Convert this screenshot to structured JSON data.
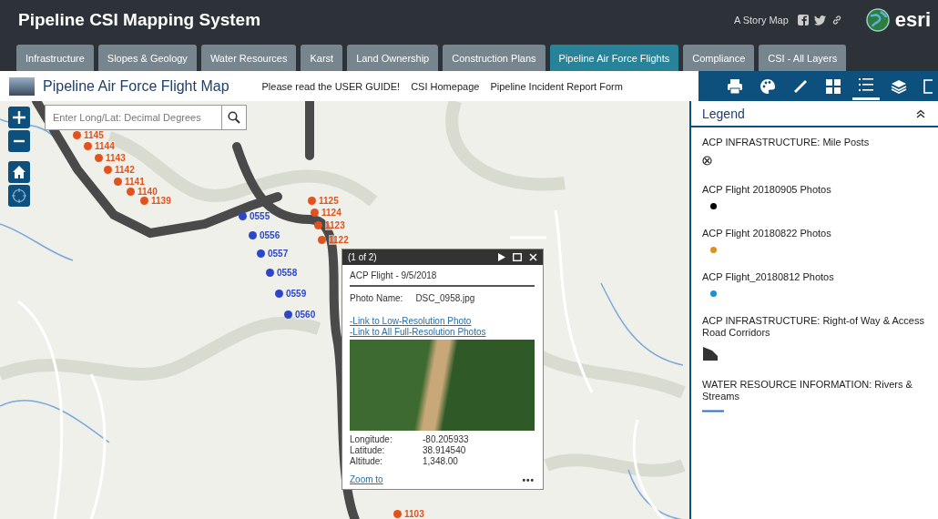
{
  "header": {
    "title": "Pipeline CSI Mapping System",
    "story_map": "A Story Map",
    "brand": "esri"
  },
  "tabs": [
    {
      "label": "Infrastructure",
      "selected": false
    },
    {
      "label": "Slopes & Geology",
      "selected": false
    },
    {
      "label": "Water Resources",
      "selected": false
    },
    {
      "label": "Karst",
      "selected": false
    },
    {
      "label": "Land Ownership",
      "selected": false
    },
    {
      "label": "Construction Plans",
      "selected": false
    },
    {
      "label": "Pipeline Air Force Flights",
      "selected": true
    },
    {
      "label": "Compliance",
      "selected": false
    },
    {
      "label": "CSI - All Layers",
      "selected": false
    }
  ],
  "subheader": {
    "title": "Pipeline Air Force Flight Map",
    "links": [
      "Please read the USER GUIDE!",
      "CSI Homepage",
      "Pipeline Incident Report Form"
    ]
  },
  "toolbar": [
    {
      "kind": "print",
      "selected": false
    },
    {
      "kind": "palette",
      "selected": false
    },
    {
      "kind": "ruler",
      "selected": false
    },
    {
      "kind": "grid",
      "selected": false
    },
    {
      "kind": "legend",
      "selected": true
    },
    {
      "kind": "layers",
      "selected": false
    },
    {
      "kind": "panel",
      "selected": false
    }
  ],
  "map": {
    "search": {
      "placeholder": "Enter Long/Lat: Decimal Degrees"
    },
    "points": [
      {
        "label": "1145",
        "color": "#e0521e"
      },
      {
        "label": "1144",
        "color": "#e0521e"
      },
      {
        "label": "1143",
        "color": "#e0521e"
      },
      {
        "label": "1142",
        "color": "#e0521e"
      },
      {
        "label": "1141",
        "color": "#e0521e"
      },
      {
        "label": "1140",
        "color": "#e0521e"
      },
      {
        "label": "1139",
        "color": "#e0521e"
      },
      {
        "label": "1125",
        "color": "#e0521e"
      },
      {
        "label": "1124",
        "color": "#e0521e"
      },
      {
        "label": "1123",
        "color": "#e0521e"
      },
      {
        "label": "1122",
        "color": "#e0521e"
      },
      {
        "label": "1103",
        "color": "#e0521e"
      },
      {
        "label": "0555",
        "color": "#2d46c8"
      },
      {
        "label": "0556",
        "color": "#2d46c8"
      },
      {
        "label": "0557",
        "color": "#2d46c8"
      },
      {
        "label": "0558",
        "color": "#2d46c8"
      },
      {
        "label": "0559",
        "color": "#2d46c8"
      },
      {
        "label": "0560",
        "color": "#2d46c8"
      }
    ]
  },
  "popup": {
    "pager": "(1 of 2)",
    "title": "ACP Flight - 9/5/2018",
    "photo_name_label": "Photo Name:",
    "photo_name": "DSC_0958.jpg",
    "links": [
      "-Link to Low-Resolution Photo",
      "-Link to All Full-Resolution Photos"
    ],
    "fields": [
      {
        "label": "Longitude:",
        "value": "-80.205933"
      },
      {
        "label": "Latitude:",
        "value": "38.914540"
      },
      {
        "label": "Altitude:",
        "value": "1,348.00"
      }
    ],
    "zoom_link": "Zoom to",
    "more": "•••"
  },
  "legend": {
    "title": "Legend",
    "items": [
      {
        "label": "ACP INFRASTRUCTURE: Mile Posts",
        "kind": "milepost"
      },
      {
        "label": "ACP Flight 20180905 Photos",
        "kind": "dot",
        "color": "#000000"
      },
      {
        "label": "ACP Flight 20180822 Photos",
        "kind": "dot",
        "color": "#e0901e"
      },
      {
        "label": "ACP Flight_20180812 Photos",
        "kind": "dot",
        "color": "#1f8fd6"
      },
      {
        "label": "ACP INFRASTRUCTURE: Right-of Way & Access Road Corridors",
        "kind": "polygon"
      },
      {
        "label": "WATER RESOURCE INFORMATION: Rivers & Streams",
        "kind": "line"
      }
    ]
  }
}
